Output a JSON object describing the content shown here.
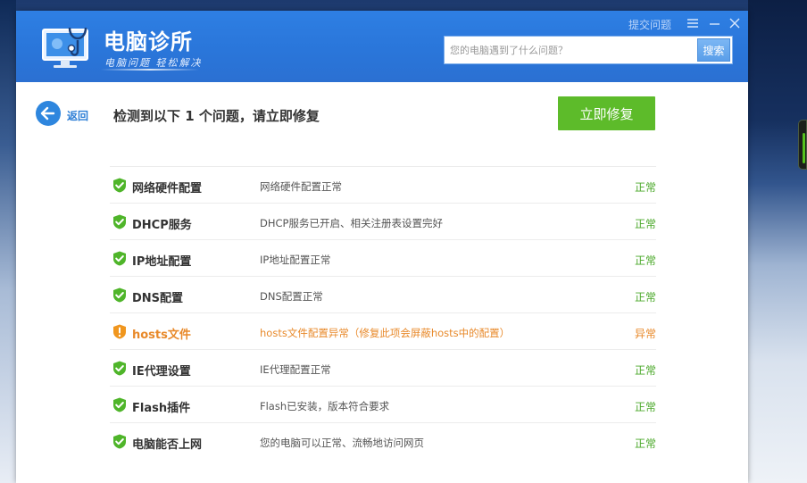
{
  "app": {
    "title": "电脑诊所",
    "slogan": "电脑问题 轻松解决",
    "feedback_label": "提交问题"
  },
  "search": {
    "placeholder": "您的电脑遇到了什么问题？",
    "button_label": "搜索"
  },
  "toolbar": {
    "back_label": "返回",
    "headline": "检测到以下 1 个问题，请立即修复",
    "fix_button_label": "立即修复"
  },
  "colors": {
    "header_blue": "#2a76da",
    "fix_green": "#5dbb2a",
    "ok_green": "#4aa829",
    "warn_orange": "#e8892a"
  },
  "items": [
    {
      "name": "网络硬件配置",
      "desc": "网络硬件配置正常",
      "status": "正常",
      "state": "ok"
    },
    {
      "name": "DHCP服务",
      "desc": "DHCP服务已开启、相关注册表设置完好",
      "status": "正常",
      "state": "ok"
    },
    {
      "name": "IP地址配置",
      "desc": "IP地址配置正常",
      "status": "正常",
      "state": "ok"
    },
    {
      "name": "DNS配置",
      "desc": "DNS配置正常",
      "status": "正常",
      "state": "ok"
    },
    {
      "name": "hosts文件",
      "desc": "hosts文件配置异常（修复此项会屏蔽hosts中的配置）",
      "status": "异常",
      "state": "warn"
    },
    {
      "name": "IE代理设置",
      "desc": "IE代理配置正常",
      "status": "正常",
      "state": "ok"
    },
    {
      "name": "Flash插件",
      "desc": "Flash已安装，版本符合要求",
      "status": "正常",
      "state": "ok"
    },
    {
      "name": "电脑能否上网",
      "desc": "您的电脑可以正常、流畅地访问网页",
      "status": "正常",
      "state": "ok"
    }
  ]
}
